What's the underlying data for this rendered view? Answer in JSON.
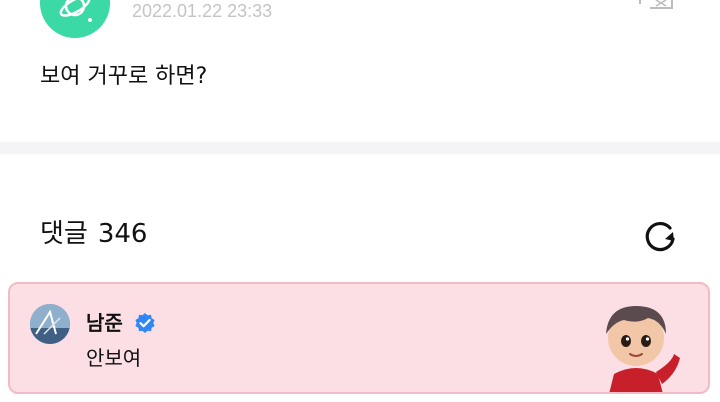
{
  "post": {
    "timestamp": "2022.01.22 23:33",
    "text": "보여 거꾸로 하면?",
    "avatar_icon": "planet-logo-icon",
    "more_icon": "translate-icon"
  },
  "comments": {
    "title": "댓글",
    "count": "346",
    "refresh_icon": "refresh-icon"
  },
  "highlighted_comment": {
    "author": "남준",
    "verified_icon": "verified-badge-icon",
    "text": "안보여",
    "sticker_icon": "character-sticker-icon"
  },
  "colors": {
    "accent": "#3bd9a6",
    "highlight_bg": "#fbdfe5",
    "highlight_border": "#f2bcc7",
    "verified": "#2f86f6",
    "timestamp": "#c4c4c4"
  }
}
